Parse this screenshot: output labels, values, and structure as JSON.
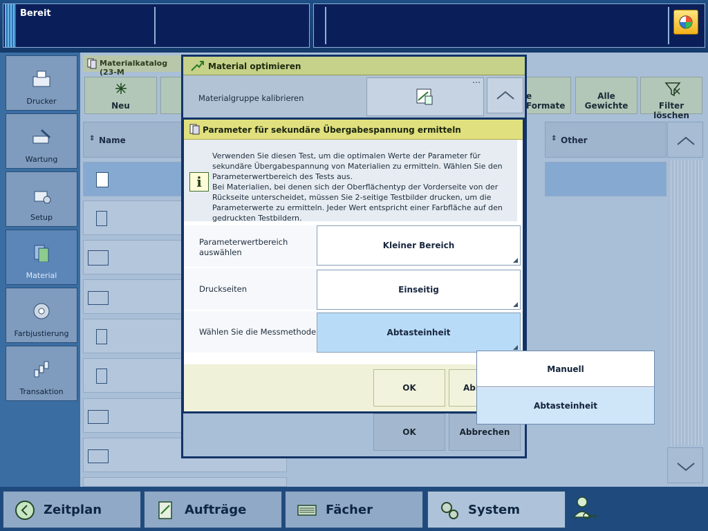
{
  "status": {
    "state": "Bereit"
  },
  "nav": {
    "items": [
      {
        "label": "Drucker",
        "icon": "printer-icon"
      },
      {
        "label": "Wartung",
        "icon": "wrench-icon"
      },
      {
        "label": "Setup",
        "icon": "setup-icon"
      },
      {
        "label": "Material",
        "icon": "material-icon",
        "active": true
      },
      {
        "label": "Farbjustierung",
        "icon": "color-adjust-icon"
      },
      {
        "label": "Transaktion",
        "icon": "transaction-icon"
      }
    ]
  },
  "catalog": {
    "title": "Materialkatalog (23-M",
    "toolbar": {
      "new_label": "Neu",
      "formats_label": "e Formate",
      "weights_label": "Alle Gewichte",
      "clear_filter_label": "Filter löschen"
    },
    "columns": {
      "name": "Name",
      "other": "Other"
    }
  },
  "outer_dialog": {
    "title": "Material optimieren",
    "row_label": "Materialgruppe kalibrieren",
    "ok_label": "OK",
    "cancel_label": "Abbrechen"
  },
  "inner_dialog": {
    "title": "Parameter für sekundäre Übergabespannung ermitteln",
    "info_text_1": "Verwenden Sie diesen Test, um die optimalen Werte der Parameter für sekundäre Übergabespannung von Materialien zu ermitteln. Wählen Sie den Parameterwertbereich des Tests aus.",
    "info_text_2": "Bei Materialien, bei denen sich der Oberflächentyp der Vorderseite von der Rückseite unterscheidet, müssen Sie 2-seitige Testbilder drucken, um die Parameterwerte zu ermitteln. Jeder Wert entspricht einer Farbfläche auf den gedruckten Testbildern.",
    "fields": [
      {
        "label": "Parameterwertbereich auswählen",
        "value": "Kleiner Bereich"
      },
      {
        "label": "Druckseiten",
        "value": "Einseitig"
      },
      {
        "label": "Wählen Sie die Messmethode",
        "value": "Abtasteinheit"
      }
    ],
    "ok_label": "OK",
    "cancel_label": "Abb"
  },
  "dropdown": {
    "options": [
      "Manuell",
      "Abtasteinheit"
    ],
    "selected": "Abtasteinheit"
  },
  "bottom_nav": {
    "items": [
      {
        "label": "Zeitplan",
        "icon": "clock-icon"
      },
      {
        "label": "Aufträge",
        "icon": "jobs-icon"
      },
      {
        "label": "Fächer",
        "icon": "trays-icon"
      },
      {
        "label": "System",
        "icon": "gears-icon"
      }
    ]
  },
  "colors": {
    "accent": "#e1e07e",
    "selected": "#b8dcf8",
    "topbar": "#0a1f5a"
  }
}
